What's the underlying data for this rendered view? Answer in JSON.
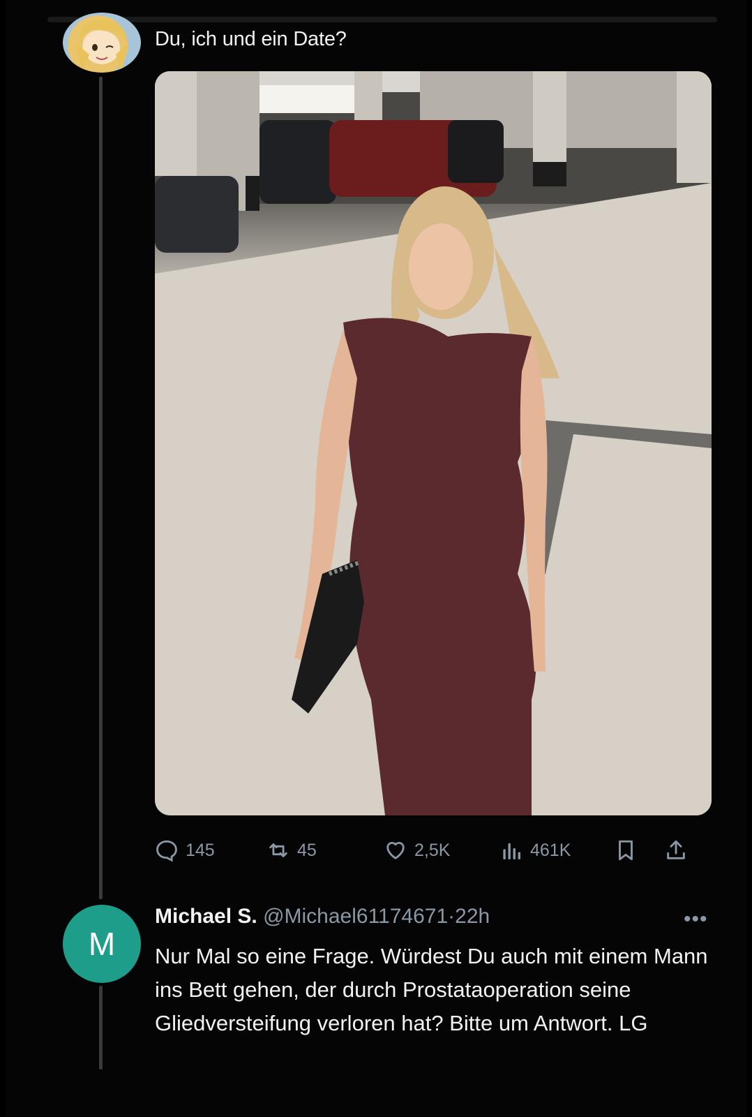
{
  "tweet": {
    "text": "Du, ich und ein Date?",
    "stats": {
      "replies": "145",
      "reposts": "45",
      "likes": "2,5K",
      "views": "461K"
    }
  },
  "reply": {
    "avatar_letter": "M",
    "name": "Michael S.",
    "handle": "@Michael61174671",
    "separator": "·",
    "time": "22h",
    "text": "Nur Mal so eine Frage. Würdest Du auch mit einem Mann ins Bett gehen, der durch Prostataoperation seine Gliedversteifung verloren hat? Bitte um Antwort. LG",
    "more": "•••"
  },
  "colors": {
    "background": "#000000",
    "text": "#f2f2f2",
    "muted": "#8b98a5",
    "avatar_bg": "#1e9e8a",
    "dress": "#5a2a2e"
  },
  "icons": [
    "reply-icon",
    "repost-icon",
    "like-icon",
    "views-icon",
    "bookmark-icon",
    "share-icon",
    "more-icon"
  ]
}
